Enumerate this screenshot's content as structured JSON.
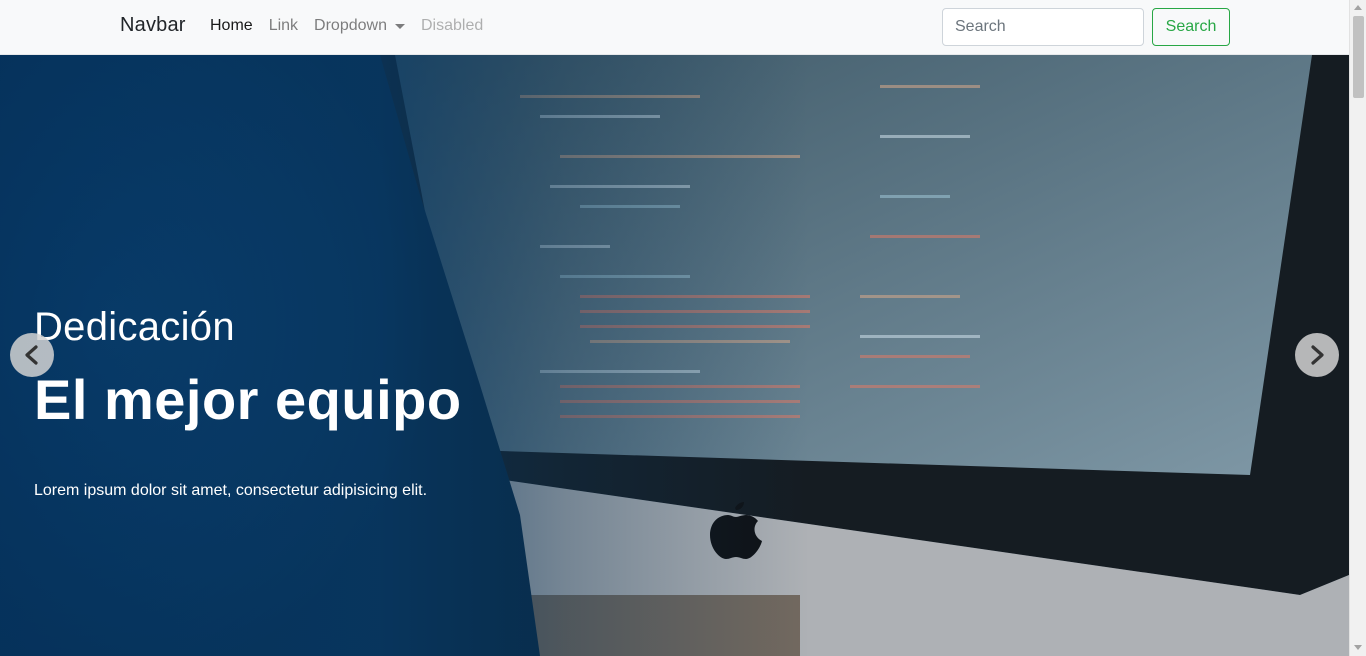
{
  "navbar": {
    "brand": "Navbar",
    "links": [
      {
        "label": "Home",
        "state": "active"
      },
      {
        "label": "Link",
        "state": "normal"
      },
      {
        "label": "Dropdown",
        "state": "normal"
      },
      {
        "label": "Disabled",
        "state": "disabled"
      }
    ],
    "search": {
      "placeholder": "Search",
      "value": "",
      "button_label": "Search"
    }
  },
  "carousel": {
    "subtitle": "Dedicación",
    "title": "El mejor equipo",
    "text": "Lorem ipsum dolor sit amet, consectetur adipisicing elit.",
    "prev_icon": "chevron-left-icon",
    "next_icon": "chevron-right-icon"
  },
  "colors": {
    "navbar_bg": "#f8f9fa",
    "success": "#28a745",
    "caption_text": "#ffffff",
    "overlay_blue": "#06325c"
  }
}
